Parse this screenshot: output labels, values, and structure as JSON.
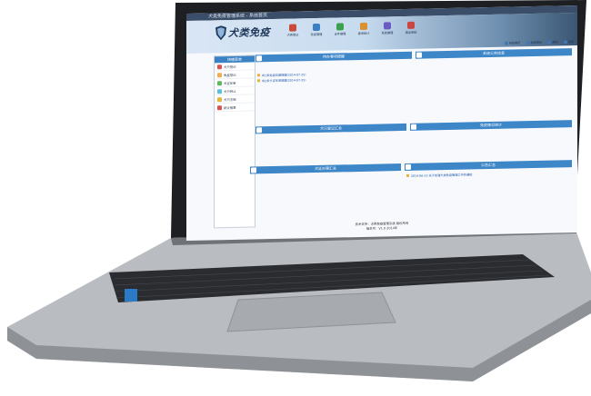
{
  "window": {
    "title": "犬类免疫管理系统 - 系统首页"
  },
  "app": {
    "logo_text": "犬类免疫"
  },
  "topnav": {
    "items": [
      {
        "label": "犬类登记",
        "color": "#c94a3a"
      },
      {
        "label": "免疫管理",
        "color": "#3b7ec4"
      },
      {
        "label": "证件管理",
        "color": "#3aa04e"
      },
      {
        "label": "查询统计",
        "color": "#d9902f"
      },
      {
        "label": "系统管理",
        "color": "#6a5ac4"
      },
      {
        "label": "退出系统",
        "color": "#c9473f"
      }
    ]
  },
  "toolbar": {
    "items": [
      "系统首页",
      "修改密码",
      "帮助",
      "退出"
    ]
  },
  "sidebar": {
    "title": "快捷菜单",
    "items": [
      {
        "label": "犬只登记",
        "color": "#d9534f"
      },
      {
        "label": "免疫登记",
        "color": "#f0ad4e"
      },
      {
        "label": "犬证年审",
        "color": "#5cb85c"
      },
      {
        "label": "犬只转让",
        "color": "#5bc0de"
      },
      {
        "label": "犬只注销",
        "color": "#e4b637"
      },
      {
        "label": "统计报表",
        "color": "#d9534f"
      }
    ]
  },
  "panels": {
    "p1": {
      "title": "待办事项提醒",
      "rows": [
        "有1条免疫到期提醒(2014-07-25)",
        "有2条犬证年审提醒(2014-07-25)"
      ]
    },
    "p2": {
      "title": "系统公告信息",
      "rows": []
    },
    "p3": {
      "title": "犬只登记汇总",
      "rows": []
    },
    "p4": {
      "title": "免疫情况统计",
      "rows": []
    },
    "p5": {
      "title": "犬证办理汇总",
      "rows": []
    },
    "p6": {
      "title": "公告汇总",
      "rows": [
        "2014-06-23 关于加强犬类免疫管理工作的通知"
      ]
    }
  },
  "footer": {
    "line1": "技术支持：犬类免疫管理系统 版权所有",
    "line2": "版本号：V1.0 2014年"
  }
}
